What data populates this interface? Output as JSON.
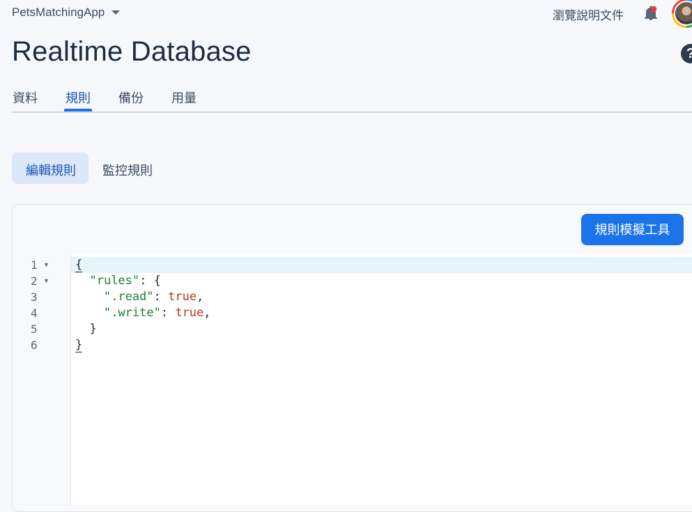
{
  "topbar": {
    "project_name": "PetsMatchingApp",
    "docs_label": "瀏覽說明文件"
  },
  "page": {
    "title": "Realtime Database"
  },
  "tabs": [
    {
      "label": "資料"
    },
    {
      "label": "規則",
      "active": true
    },
    {
      "label": "備份"
    },
    {
      "label": "用量"
    }
  ],
  "subtabs": [
    {
      "label": "編輯規則",
      "active": true
    },
    {
      "label": "監控規則"
    }
  ],
  "toolbar": {
    "simulator_label": "規則模擬工具"
  },
  "editor": {
    "line_numbers": [
      "1",
      "2",
      "3",
      "4",
      "5",
      "6"
    ],
    "lines": [
      {
        "text": "{"
      },
      {
        "indent": "  ",
        "key": "\"rules\"",
        "rest": ": {"
      },
      {
        "indent": "    ",
        "key": "\".read\"",
        "sep": ": ",
        "value": "true",
        "tail": ","
      },
      {
        "indent": "    ",
        "key": "\".write\"",
        "sep": ": ",
        "value": "true",
        "tail": ","
      },
      {
        "text": "  }"
      },
      {
        "text": "}"
      }
    ]
  },
  "colors": {
    "accent": "#1a73e8",
    "string_key": "#1b7f3e",
    "literal": "#b5341e",
    "active_line": "#e4f4fb"
  }
}
